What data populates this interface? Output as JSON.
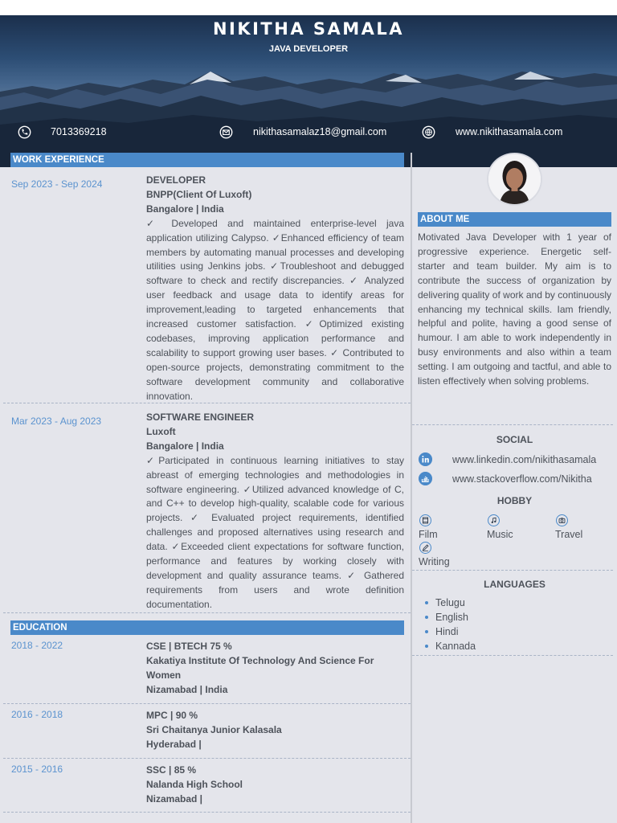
{
  "header": {
    "name": "NIKITHA SAMALA",
    "role": "JAVA DEVELOPER",
    "phone": "7013369218",
    "email": "nikithasamalaz18@gmail.com",
    "website": "www.nikithasamala.com"
  },
  "colors": {
    "accent": "#4a89c9",
    "panel": "#e4e5eb",
    "date": "#5b93cf",
    "header_dark": "#1b2f4c"
  },
  "work": {
    "title": "WORK EXPERIENCE",
    "jobs": [
      {
        "dates": "Sep 2023 - Sep 2024",
        "position": "DEVELOPER",
        "company": "BNPP(Client Of Luxoft)",
        "location": "Bangalore | India",
        "description": "✓ Developed and maintained enterprise-level java application utilizing Calypso. ✓Enhanced efficiency of team members by automating manual processes and developing utilities using Jenkins jobs. ✓Troubleshoot and debugged software to check and rectify discrepancies. ✓ Analyzed user feedback and usage data to identify areas for improvement,leading to targeted enhancements that increased customer satisfaction. ✓Optimized existing codebases, improving application performance and scalability to support growing user bases. ✓ Contributed to open-source projects, demonstrating commitment to the software development community and collaborative innovation."
      },
      {
        "dates": "Mar 2023 - Aug 2023",
        "position": "SOFTWARE ENGINEER",
        "company": "Luxoft",
        "location": "Bangalore | India",
        "description": "✓Participated in continuous learning initiatives to stay abreast of emerging technologies and methodologies in software engineering. ✓Utilized advanced knowledge of C, and C++ to develop high-quality, scalable code for various projects. ✓ Evaluated project requirements, identified challenges and proposed alternatives using research and data. ✓Exceeded client expectations for software function, performance and features by working closely with development and quality assurance teams. ✓ Gathered requirements from users and wrote definition documentation."
      }
    ]
  },
  "education": {
    "title": "EDUCATION",
    "items": [
      {
        "dates": "2018 - 2022",
        "degree": "CSE | BTECH 75 %",
        "school": "Kakatiya Institute Of Technology And Science For Women",
        "location": "Nizamabad | India"
      },
      {
        "dates": "2016 - 2018",
        "degree": "MPC | 90 %",
        "school": "Sri Chaitanya Junior Kalasala",
        "location": "Hyderabad |"
      },
      {
        "dates": "2015 - 2016",
        "degree": "SSC | 85 %",
        "school": "Nalanda High School",
        "location": "Nizamabad |"
      }
    ]
  },
  "about": {
    "title": "ABOUT ME",
    "text": "Motivated Java Developer with 1 year of progressive experience. Energetic self-starter and team builder. My aim is to contribute the success of organization by delivering quality of work and by continuously enhancing my technical skills. Iam friendly, helpful and polite, having a good sense of humour. I am able to work independently in busy environments and also within a team setting. I am outgoing and tactful, and able to listen effectively when solving problems."
  },
  "social": {
    "title": "SOCIAL",
    "items": [
      {
        "icon": "linkedin-icon",
        "text": "www.linkedin.com/nikithasamala"
      },
      {
        "icon": "stackoverflow-icon",
        "text": "www.stackoverflow.com/Nikitha"
      }
    ]
  },
  "hobby": {
    "title": "HOBBY",
    "items": [
      {
        "icon": "film-icon",
        "label": "Film"
      },
      {
        "icon": "music-icon",
        "label": "Music"
      },
      {
        "icon": "camera-icon",
        "label": "Travel"
      },
      {
        "icon": "pen-icon",
        "label": "Writing"
      }
    ]
  },
  "languages": {
    "title": "LANGUAGES",
    "items": [
      "Telugu",
      "English",
      "Hindi",
      "Kannada"
    ]
  }
}
